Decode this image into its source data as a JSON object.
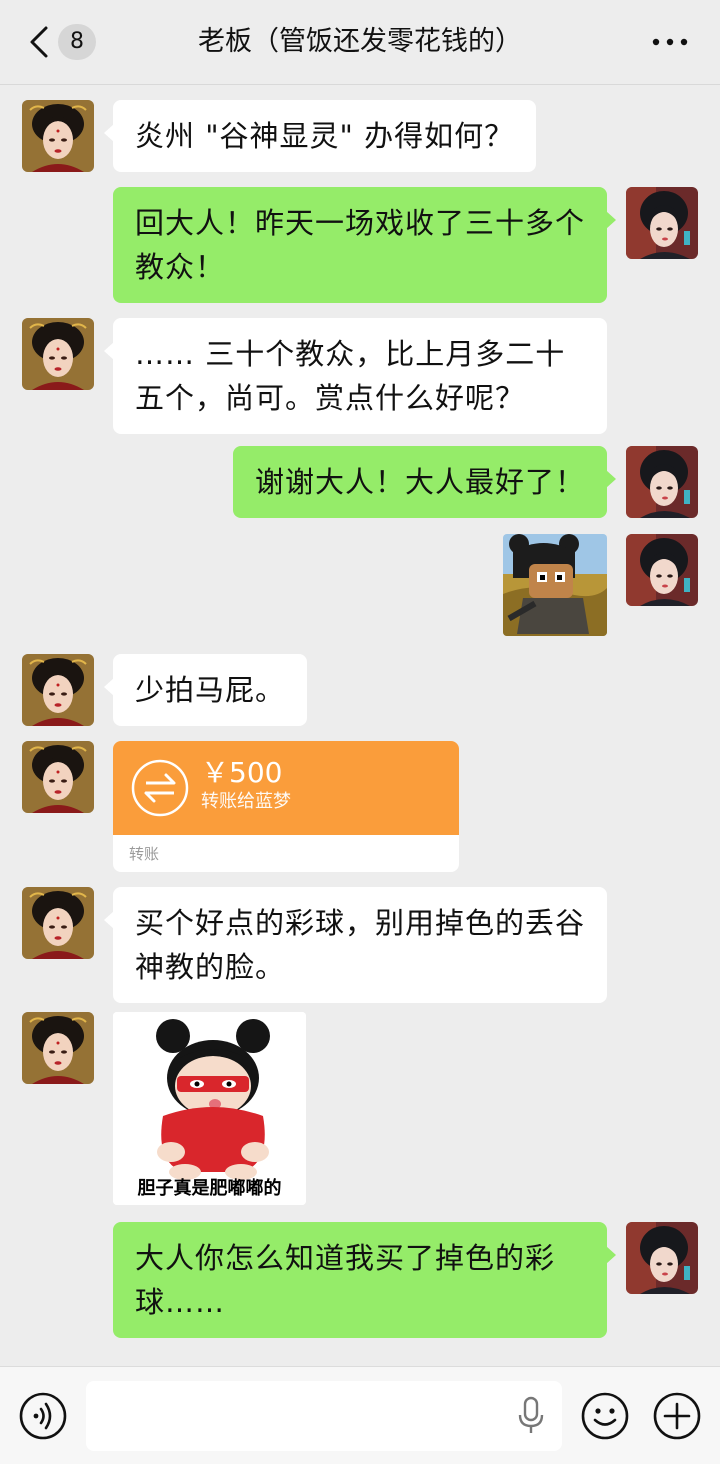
{
  "header": {
    "unread_count": "8",
    "title": "老板（管饭还发零花钱的）"
  },
  "messages": [
    {
      "side": "left",
      "text": "炎州 \"谷神显灵\" 办得如何？"
    },
    {
      "side": "right",
      "text": "回大人！昨天一场戏收了三十多个教众！"
    },
    {
      "side": "left",
      "text": "…… 三十个教众，比上月多二十五个，尚可。赏点什么好呢？"
    },
    {
      "side": "right",
      "text": "谢谢大人！大人最好了！"
    },
    {
      "side": "right",
      "type": "sticker"
    },
    {
      "side": "left",
      "text": "少拍马屁。"
    },
    {
      "side": "left",
      "type": "transfer"
    },
    {
      "side": "left",
      "text": "买个好点的彩球，别用掉色的丢谷神教的脸。"
    },
    {
      "side": "left",
      "type": "sticker"
    },
    {
      "side": "right",
      "text": "大人你怎么知道我买了掉色的彩球……"
    }
  ],
  "transfer": {
    "amount": "￥500",
    "description": "转账给蓝梦",
    "footer": "转账"
  },
  "sticker_caption": "胆子真是肥嘟嘟的",
  "colors": {
    "background": "#ededed",
    "bubble_self": "#95ec69",
    "bubble_other": "#ffffff",
    "transfer": "#fa9d3b"
  },
  "icons": [
    "chevron-left-icon",
    "more-dots-icon",
    "voice-icon",
    "mic-icon",
    "emoji-icon",
    "plus-icon",
    "transfer-arrows-icon"
  ]
}
